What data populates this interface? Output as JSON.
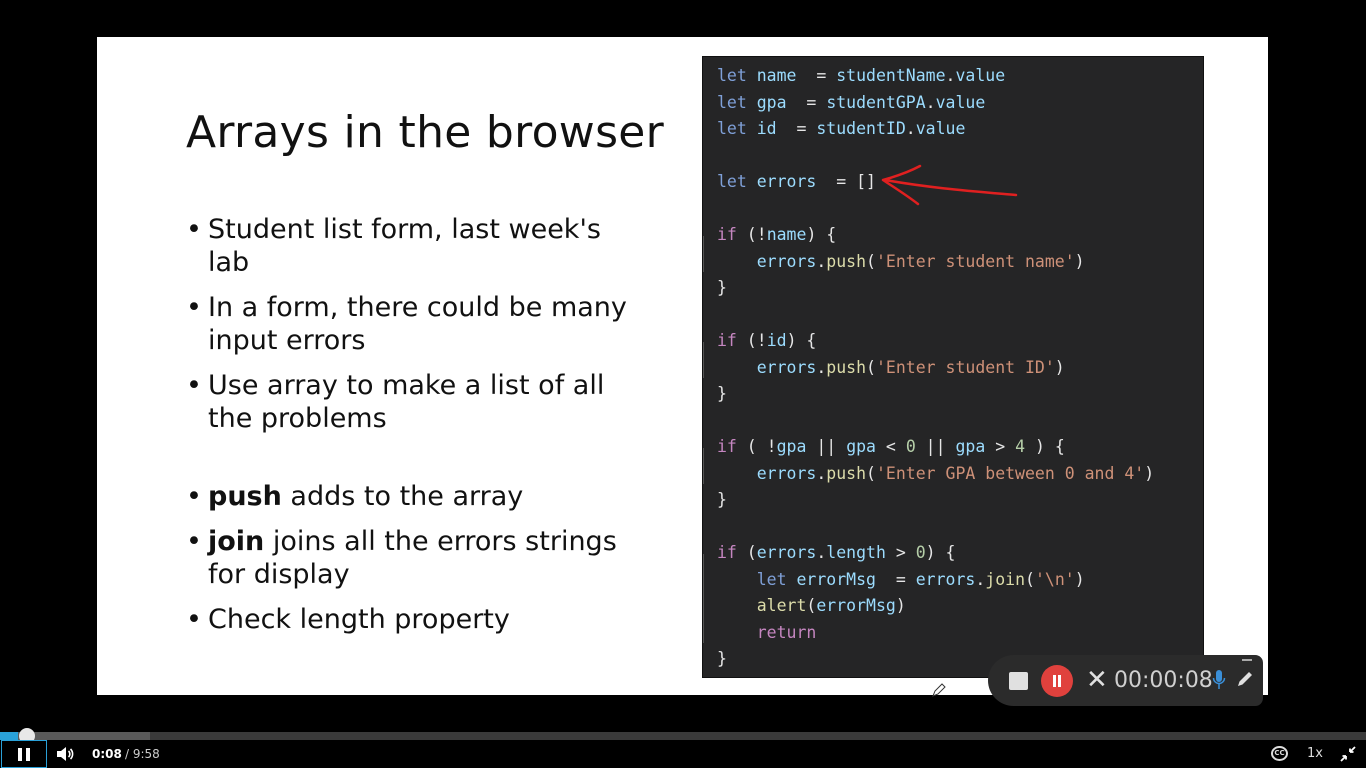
{
  "slide": {
    "title": "Arrays in the browser",
    "bullets": [
      {
        "bold": "",
        "text": "Student list form, last week's lab"
      },
      {
        "bold": "",
        "text": "In a form, there could be many input errors"
      },
      {
        "bold": "",
        "text": "Use array to make a list of all the problems"
      },
      {
        "bold": "push",
        "text": " adds to the array"
      },
      {
        "bold": "join",
        "text": " joins all the errors strings for display"
      },
      {
        "bold": "",
        "text": "Check length property"
      }
    ]
  },
  "code_lines": [
    [
      [
        "kwb",
        "let"
      ],
      [
        "var",
        " name"
      ],
      [
        "",
        "  = "
      ],
      [
        "var",
        "studentName"
      ],
      [
        "",
        "."
      ],
      [
        "var",
        "value"
      ]
    ],
    [
      [
        "kwb",
        "let"
      ],
      [
        "var",
        " gpa"
      ],
      [
        "",
        "  = "
      ],
      [
        "var",
        "studentGPA"
      ],
      [
        "",
        "."
      ],
      [
        "var",
        "value"
      ]
    ],
    [
      [
        "kwb",
        "let"
      ],
      [
        "var",
        " id"
      ],
      [
        "",
        "  = "
      ],
      [
        "var",
        "studentID"
      ],
      [
        "",
        "."
      ],
      [
        "var",
        "value"
      ]
    ],
    [],
    [
      [
        "kwb",
        "let"
      ],
      [
        "var",
        " errors"
      ],
      [
        "",
        "  = []"
      ]
    ],
    [],
    [
      [
        "kw",
        "if"
      ],
      [
        "",
        " (!"
      ],
      [
        "var",
        "name"
      ],
      [
        "",
        ") {"
      ]
    ],
    [
      [
        "",
        "    "
      ],
      [
        "var",
        "errors"
      ],
      [
        "",
        "."
      ],
      [
        "fn",
        "push"
      ],
      [
        "",
        "("
      ],
      [
        "str",
        "'Enter student name'"
      ],
      [
        "",
        ")"
      ]
    ],
    [
      [
        "",
        "}"
      ]
    ],
    [],
    [
      [
        "kw",
        "if"
      ],
      [
        "",
        " (!"
      ],
      [
        "var",
        "id"
      ],
      [
        "",
        ") {"
      ]
    ],
    [
      [
        "",
        "    "
      ],
      [
        "var",
        "errors"
      ],
      [
        "",
        "."
      ],
      [
        "fn",
        "push"
      ],
      [
        "",
        "("
      ],
      [
        "str",
        "'Enter student ID'"
      ],
      [
        "",
        ")"
      ]
    ],
    [
      [
        "",
        "}"
      ]
    ],
    [],
    [
      [
        "kw",
        "if"
      ],
      [
        "",
        " ( !"
      ],
      [
        "var",
        "gpa"
      ],
      [
        "",
        " || "
      ],
      [
        "var",
        "gpa"
      ],
      [
        "",
        " < "
      ],
      [
        "num",
        "0"
      ],
      [
        "",
        " || "
      ],
      [
        "var",
        "gpa"
      ],
      [
        "",
        " > "
      ],
      [
        "num",
        "4"
      ],
      [
        "",
        " ) {"
      ]
    ],
    [
      [
        "",
        "    "
      ],
      [
        "var",
        "errors"
      ],
      [
        "",
        "."
      ],
      [
        "fn",
        "push"
      ],
      [
        "",
        "("
      ],
      [
        "str",
        "'Enter GPA between 0 and 4'"
      ],
      [
        "",
        ")"
      ]
    ],
    [
      [
        "",
        "}"
      ]
    ],
    [],
    [
      [
        "kw",
        "if"
      ],
      [
        "",
        " ("
      ],
      [
        "var",
        "errors"
      ],
      [
        "",
        "."
      ],
      [
        "var",
        "length"
      ],
      [
        "",
        " > "
      ],
      [
        "num",
        "0"
      ],
      [
        "",
        ") {"
      ]
    ],
    [
      [
        "",
        "    "
      ],
      [
        "kwb",
        "let"
      ],
      [
        "var",
        " errorMsg"
      ],
      [
        "",
        "  = "
      ],
      [
        "var",
        "errors"
      ],
      [
        "",
        "."
      ],
      [
        "fn",
        "join"
      ],
      [
        "",
        "("
      ],
      [
        "str",
        "'\\n'"
      ],
      [
        "",
        ")"
      ]
    ],
    [
      [
        "",
        "    "
      ],
      [
        "fn",
        "alert"
      ],
      [
        "",
        "("
      ],
      [
        "var",
        "errorMsg"
      ],
      [
        "",
        ")"
      ]
    ],
    [
      [
        "",
        "    "
      ],
      [
        "kw",
        "return"
      ]
    ],
    [
      [
        "",
        "}"
      ]
    ]
  ],
  "recorder": {
    "elapsed": "00:00:08",
    "accent": "#e0413d"
  },
  "player": {
    "current_time": "0:08",
    "duration": "/ 9:58",
    "speed": "1x",
    "cc_label": "CC",
    "progress_fraction": 0.0134,
    "buffered_fraction": 0.11,
    "accent": "#2aa1d8"
  }
}
